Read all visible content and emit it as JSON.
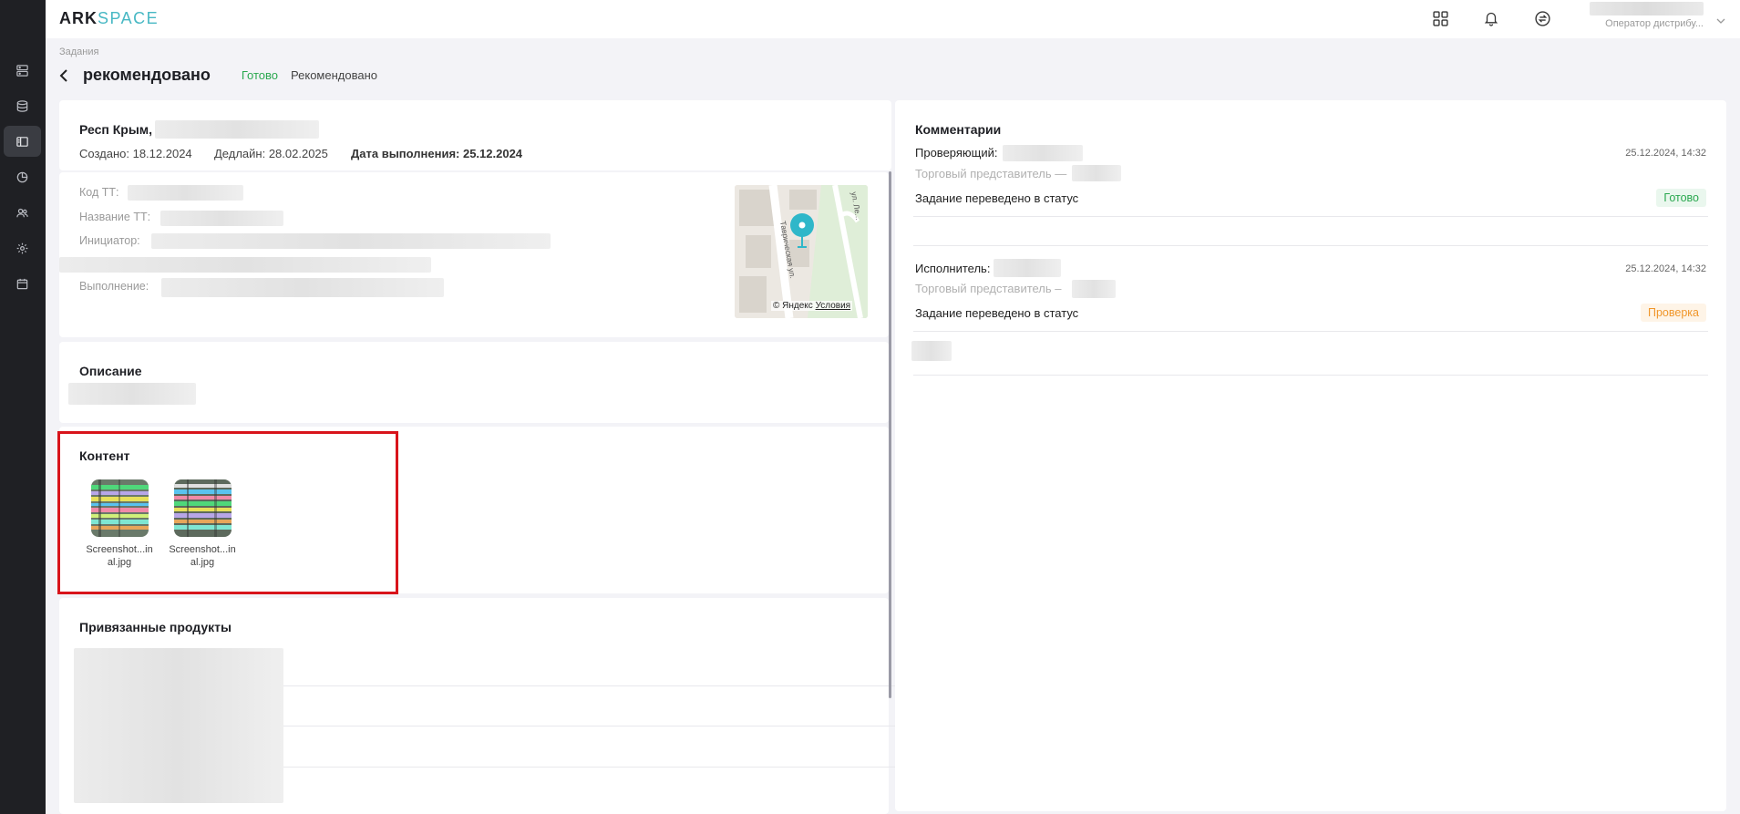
{
  "app": {
    "logo_ark": "ARK",
    "logo_space": "SPACE",
    "user_role": "Оператор дистрибу..."
  },
  "breadcrumb": "Задания",
  "page": {
    "title": "рекомендовано",
    "status_ready": "Готово",
    "status_recommended": "Рекомендовано"
  },
  "task": {
    "region": "Респ Крым,",
    "created": "Создано: 18.12.2024",
    "deadline": "Дедлайн: 28.02.2025",
    "completed_label": "Дата выполнения: 25.12.2024",
    "code_label": "Код ТТ:",
    "name_label": "Название ТТ:",
    "initiator_label": "Инициатор:",
    "execution_label": "Выполнение:",
    "map_attribution": "© Яндекс",
    "map_terms": "Условия",
    "map_street": "Таврическая ул.",
    "map_street2": "ул. Ле..."
  },
  "description": {
    "title": "Описание"
  },
  "content": {
    "title": "Контент",
    "files": [
      {
        "name_line1": "Screenshot...in",
        "name_line2": "al.jpg"
      },
      {
        "name_line1": "Screenshot...in",
        "name_line2": "al.jpg"
      }
    ]
  },
  "products": {
    "title": "Привязанные продукты"
  },
  "comments": {
    "title": "Комментарии",
    "items": [
      {
        "role": "Проверяющий:",
        "date": "25.12.2024, 14:32",
        "sub": "Торговый представитель —",
        "text": "Задание переведено в статус",
        "status": "Готово",
        "status_color": "#2aa84f"
      },
      {
        "role": "Исполнитель:",
        "date": "25.12.2024, 14:32",
        "sub": "Торговый представитель –",
        "text": "Задание переведено в статус",
        "status": "Проверка",
        "status_color": "#f0962a"
      }
    ]
  },
  "colors": {
    "accent": "#48b8c4",
    "sidebar": "#1f2024",
    "highlight": "#d8141b"
  }
}
